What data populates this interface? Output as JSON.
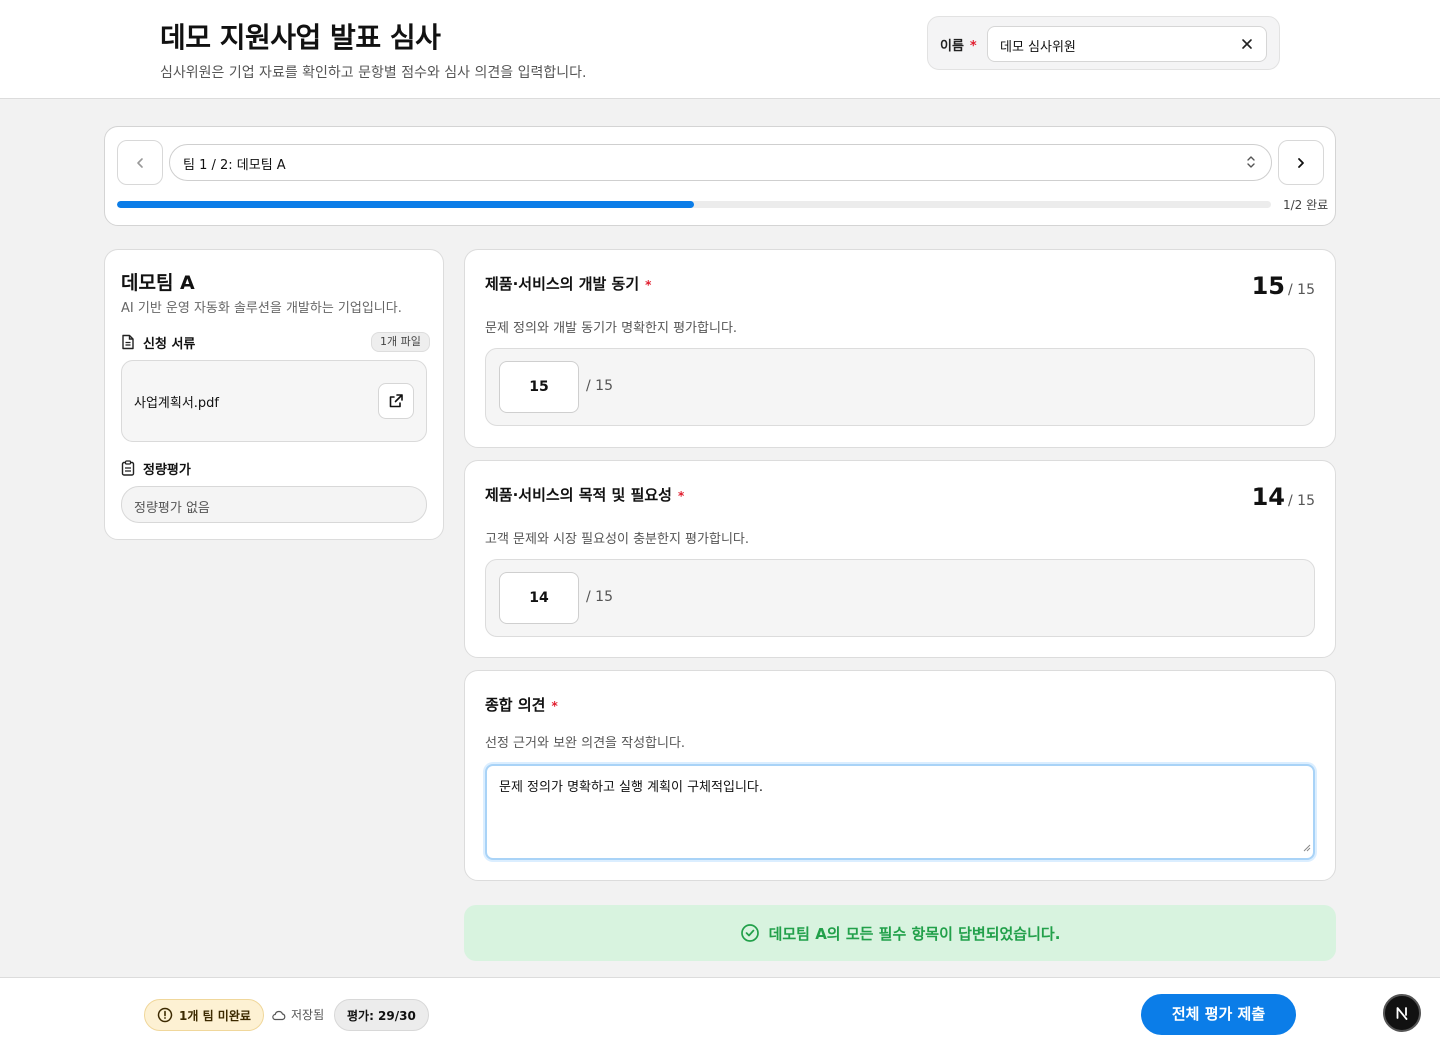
{
  "header": {
    "title": "데모 지원사업 발표 심사",
    "subtitle": "심사위원은 기업 자료를 확인하고 문항별 점수와 심사 의견을 입력합니다.",
    "name_label": "이름",
    "required_mark": "*",
    "name_value": "데모 심사위원"
  },
  "team_nav": {
    "selected_team": "팀 1 / 2: 데모팀 A",
    "progress_fraction": 0.5,
    "progress_text": "1/2 완료"
  },
  "team_info": {
    "name": "데모팀 A",
    "description": "AI 기반 운영 자동화 솔루션을 개발하는 기업입니다.",
    "documents_label": "신청 서류",
    "file_count": "1개 파일",
    "file_name": "사업계획서.pdf",
    "quant_label": "정량평가",
    "quant_value": "정량평가 없음"
  },
  "questions": [
    {
      "title": "제품·서비스의 개발 동기",
      "required_mark": "*",
      "score_big": "15",
      "score_max": "/ 15",
      "description": "문제 정의와 개발 동기가 명확한지 평가합니다.",
      "input_value": "15",
      "input_max": "/ 15"
    },
    {
      "title": "제품·서비스의 목적 및 필요성",
      "required_mark": "*",
      "score_big": "14",
      "score_max": "/ 15",
      "description": "고객 문제와 시장 필요성이 충분한지 평가합니다.",
      "input_value": "14",
      "input_max": "/ 15"
    }
  ],
  "comment": {
    "title": "종합 의견",
    "required_mark": "*",
    "description": "선정 근거와 보완 의견을 작성합니다.",
    "value": "문제 정의가 명확하고 실행 계획이 구체적입니다."
  },
  "banner": {
    "text": "데모팀 A의 모든 필수 항목이 답변되었습니다."
  },
  "footer": {
    "incomplete": "1개 팀 미완료",
    "save_status": "저장됨",
    "eval_count": "평가: 29/30",
    "submit_label": "전체 평가 제출"
  },
  "colors": {
    "accent": "#0b7de8",
    "required": "#e11d2e",
    "success": "#22a04a",
    "warn_bg": "#fdf1d3"
  }
}
